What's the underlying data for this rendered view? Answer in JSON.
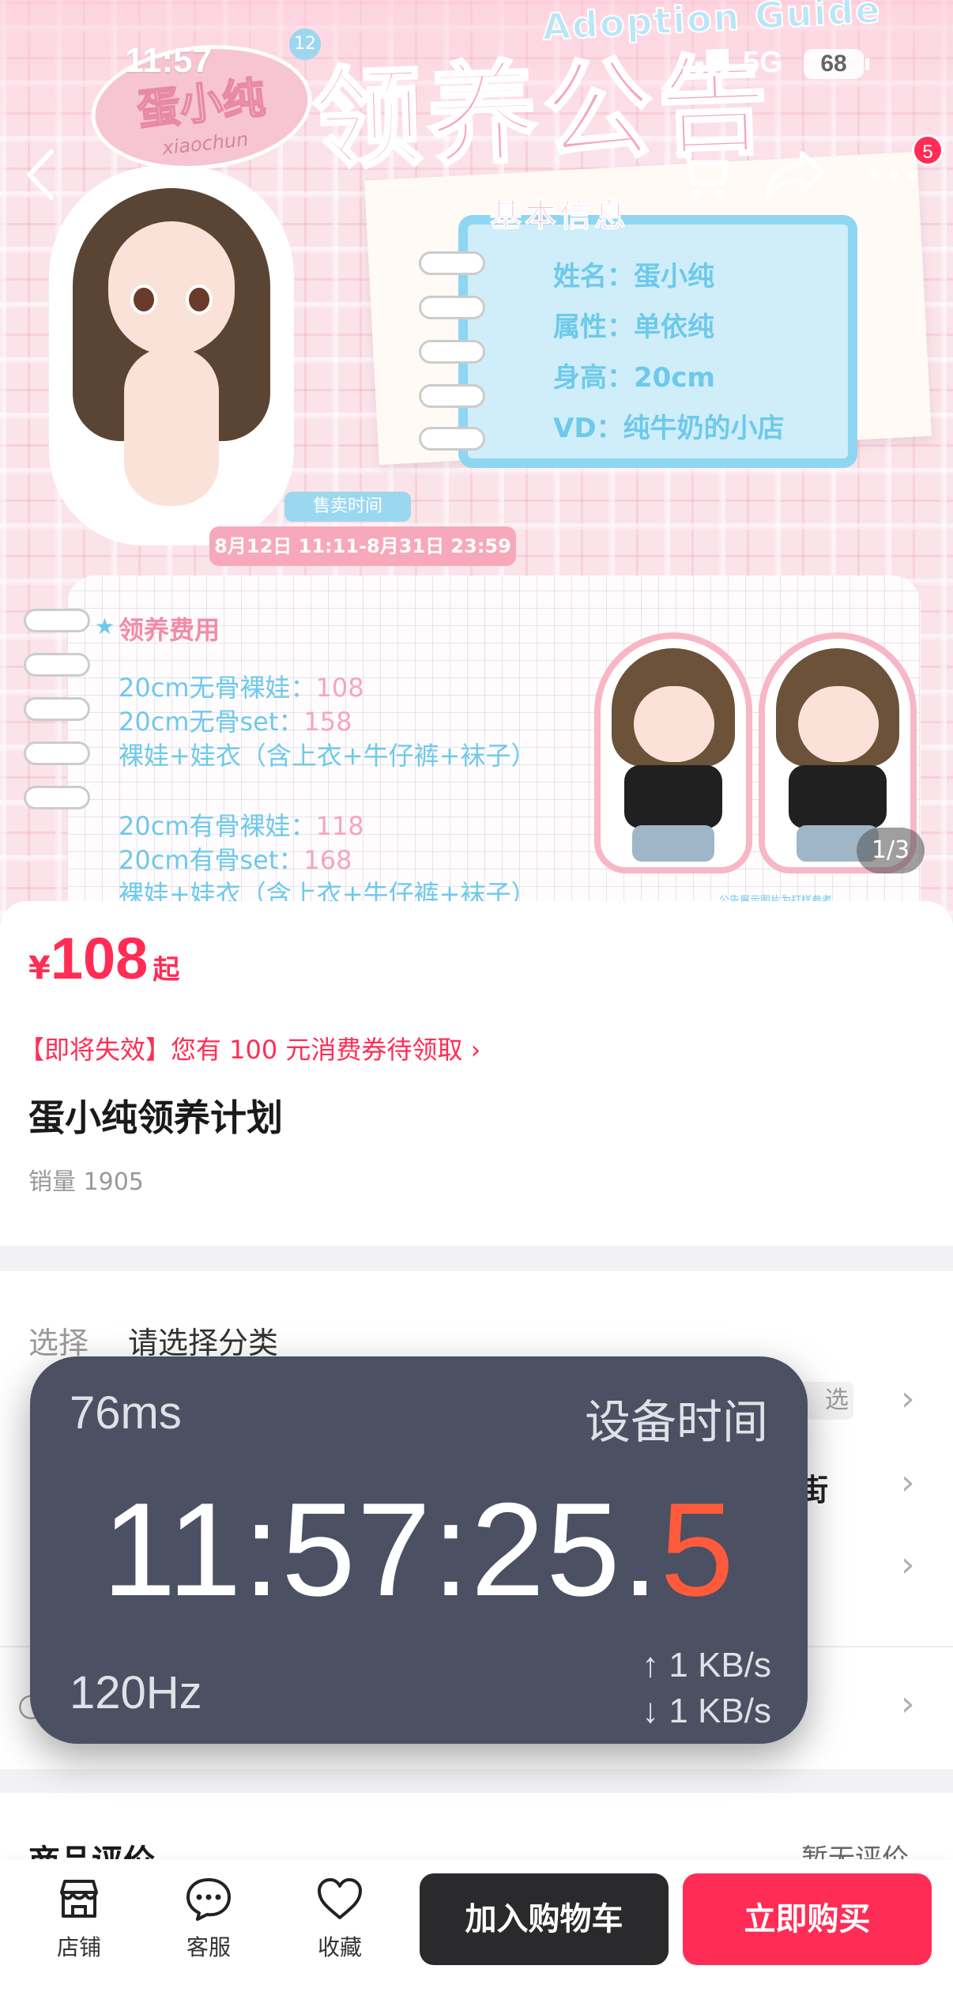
{
  "status_bar": {
    "time": "11:57",
    "network": "5G",
    "battery": "68"
  },
  "hero": {
    "header_text": "Adoption Guide",
    "title": "领养公告",
    "badge_number": "12",
    "doll_name": "蛋小纯",
    "doll_name_romanized": "xiaochun",
    "info_heading": "基本信息",
    "info_lines": [
      "姓名：蛋小纯",
      "属性：单依纯",
      "身高：20cm",
      "VD：纯牛奶的小店"
    ],
    "sale_time_label": "售卖时间",
    "sale_time": "8月12日 11:11-8月31日 23:59",
    "fee_heading": "领养费用",
    "fee_lines": [
      {
        "text": "20cm无骨裸娃：",
        "value": "108"
      },
      {
        "text": "20cm无骨set：",
        "value": "158"
      },
      {
        "text": "裸娃+娃衣（含上衣+牛仔裤+袜子）",
        "value": ""
      },
      {
        "text": "20cm有骨裸娃：",
        "value": "118"
      },
      {
        "text": "20cm有骨set：",
        "value": "168"
      },
      {
        "text": "裸娃+娃衣（含上衣+牛仔裤+袜子）",
        "value": ""
      }
    ],
    "disclaimer": "公告展示图片为打样参考",
    "page_indicator": "1/3"
  },
  "nav": {
    "notification_count": "5",
    "icons": [
      "back-icon",
      "cart-icon",
      "share-icon",
      "more-icon"
    ]
  },
  "product": {
    "price_symbol": "¥",
    "price": "108",
    "price_suffix": "起",
    "coupon_text": "【即将失效】您有 100 元消费券待领取 ›",
    "title": "蛋小纯领养计划",
    "sales": "销量 1905"
  },
  "options": {
    "select_label": "选择",
    "select_value": "请选择分类",
    "partial_chip": "选",
    "partial_text": "街"
  },
  "reviews": {
    "title": "商品评价",
    "empty": "暂无评价"
  },
  "timer_overlay": {
    "latency": "76ms",
    "label": "设备时间",
    "clock_main": "11:57:25.",
    "clock_fraction": "5",
    "refresh_rate": "120Hz",
    "upload": "↑ 1 KB/s",
    "download": "↓ 1 KB/s"
  },
  "bottom_bar": {
    "tabs": [
      {
        "label": "店铺",
        "icon": "store-icon"
      },
      {
        "label": "客服",
        "icon": "chat-icon"
      },
      {
        "label": "收藏",
        "icon": "heart-icon"
      }
    ],
    "add_to_cart": "加入购物车",
    "buy_now": "立即购买"
  },
  "colors": {
    "accent": "#ff2d55",
    "timer_bg": "#4b5063",
    "timer_fraction": "#ff5a3c",
    "hero_pink": "#f4a8bd",
    "hero_blue": "#6ec9ea"
  }
}
